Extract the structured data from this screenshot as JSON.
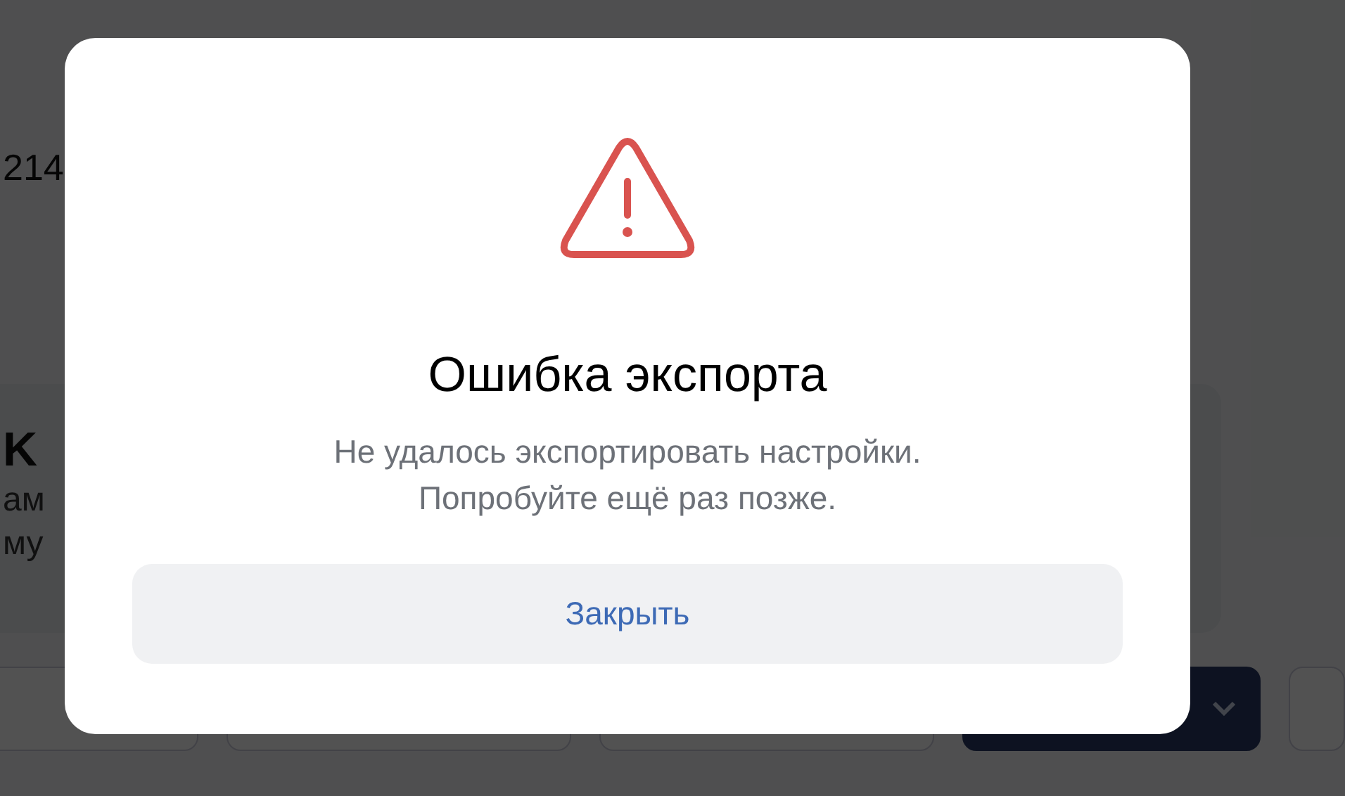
{
  "background": {
    "number": "214",
    "card": {
      "title": "K",
      "line_1": "ам",
      "line_2": "му"
    }
  },
  "dialog": {
    "title": "Ошибка экспорта",
    "message": "Не удалось экспортировать настройки.\nПопробуйте ещё раз позже.",
    "button": "Закрыть"
  }
}
